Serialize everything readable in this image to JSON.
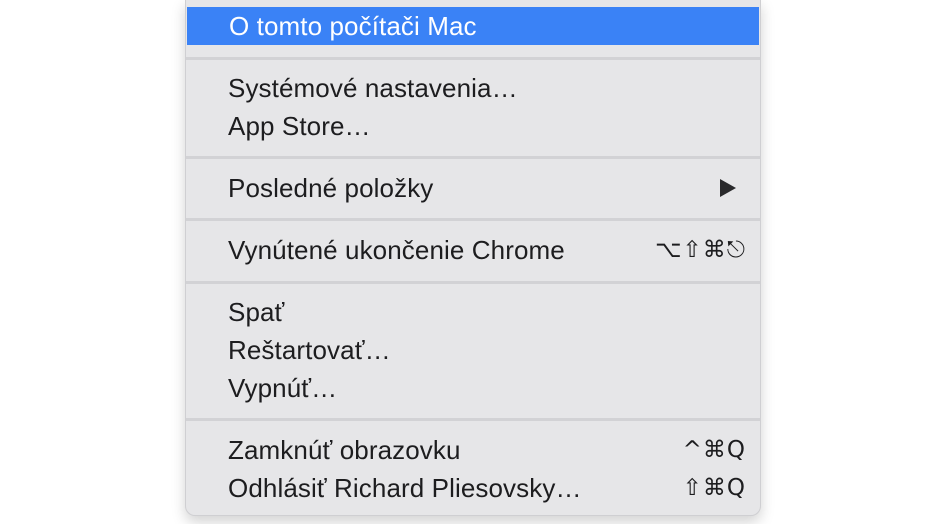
{
  "menu": {
    "items": [
      {
        "label": "O tomto počítači Mac",
        "shortcut": ""
      },
      {
        "label": "Systémové nastavenia…",
        "shortcut": ""
      },
      {
        "label": "App Store…",
        "shortcut": ""
      },
      {
        "label": "Posledné položky",
        "shortcut": ""
      },
      {
        "label": "Vynútené ukončenie Chrome",
        "shortcut": "⌥⇧⌘⎋"
      },
      {
        "label": "Spať",
        "shortcut": ""
      },
      {
        "label": "Reštartovať…",
        "shortcut": ""
      },
      {
        "label": "Vypnúť…",
        "shortcut": ""
      },
      {
        "label": "Zamknúť obrazovku",
        "shortcut": "^⌘Q"
      },
      {
        "label": "Odhlásiť Richard Pliesovsky…",
        "shortcut": "⇧⌘Q"
      }
    ],
    "submenu_icon": "chevron-right-icon",
    "colors": {
      "background": "#e6e6e8",
      "highlight": "#3a82f6",
      "text": "#1d1d1f",
      "separator": "#d2d2d5"
    }
  }
}
